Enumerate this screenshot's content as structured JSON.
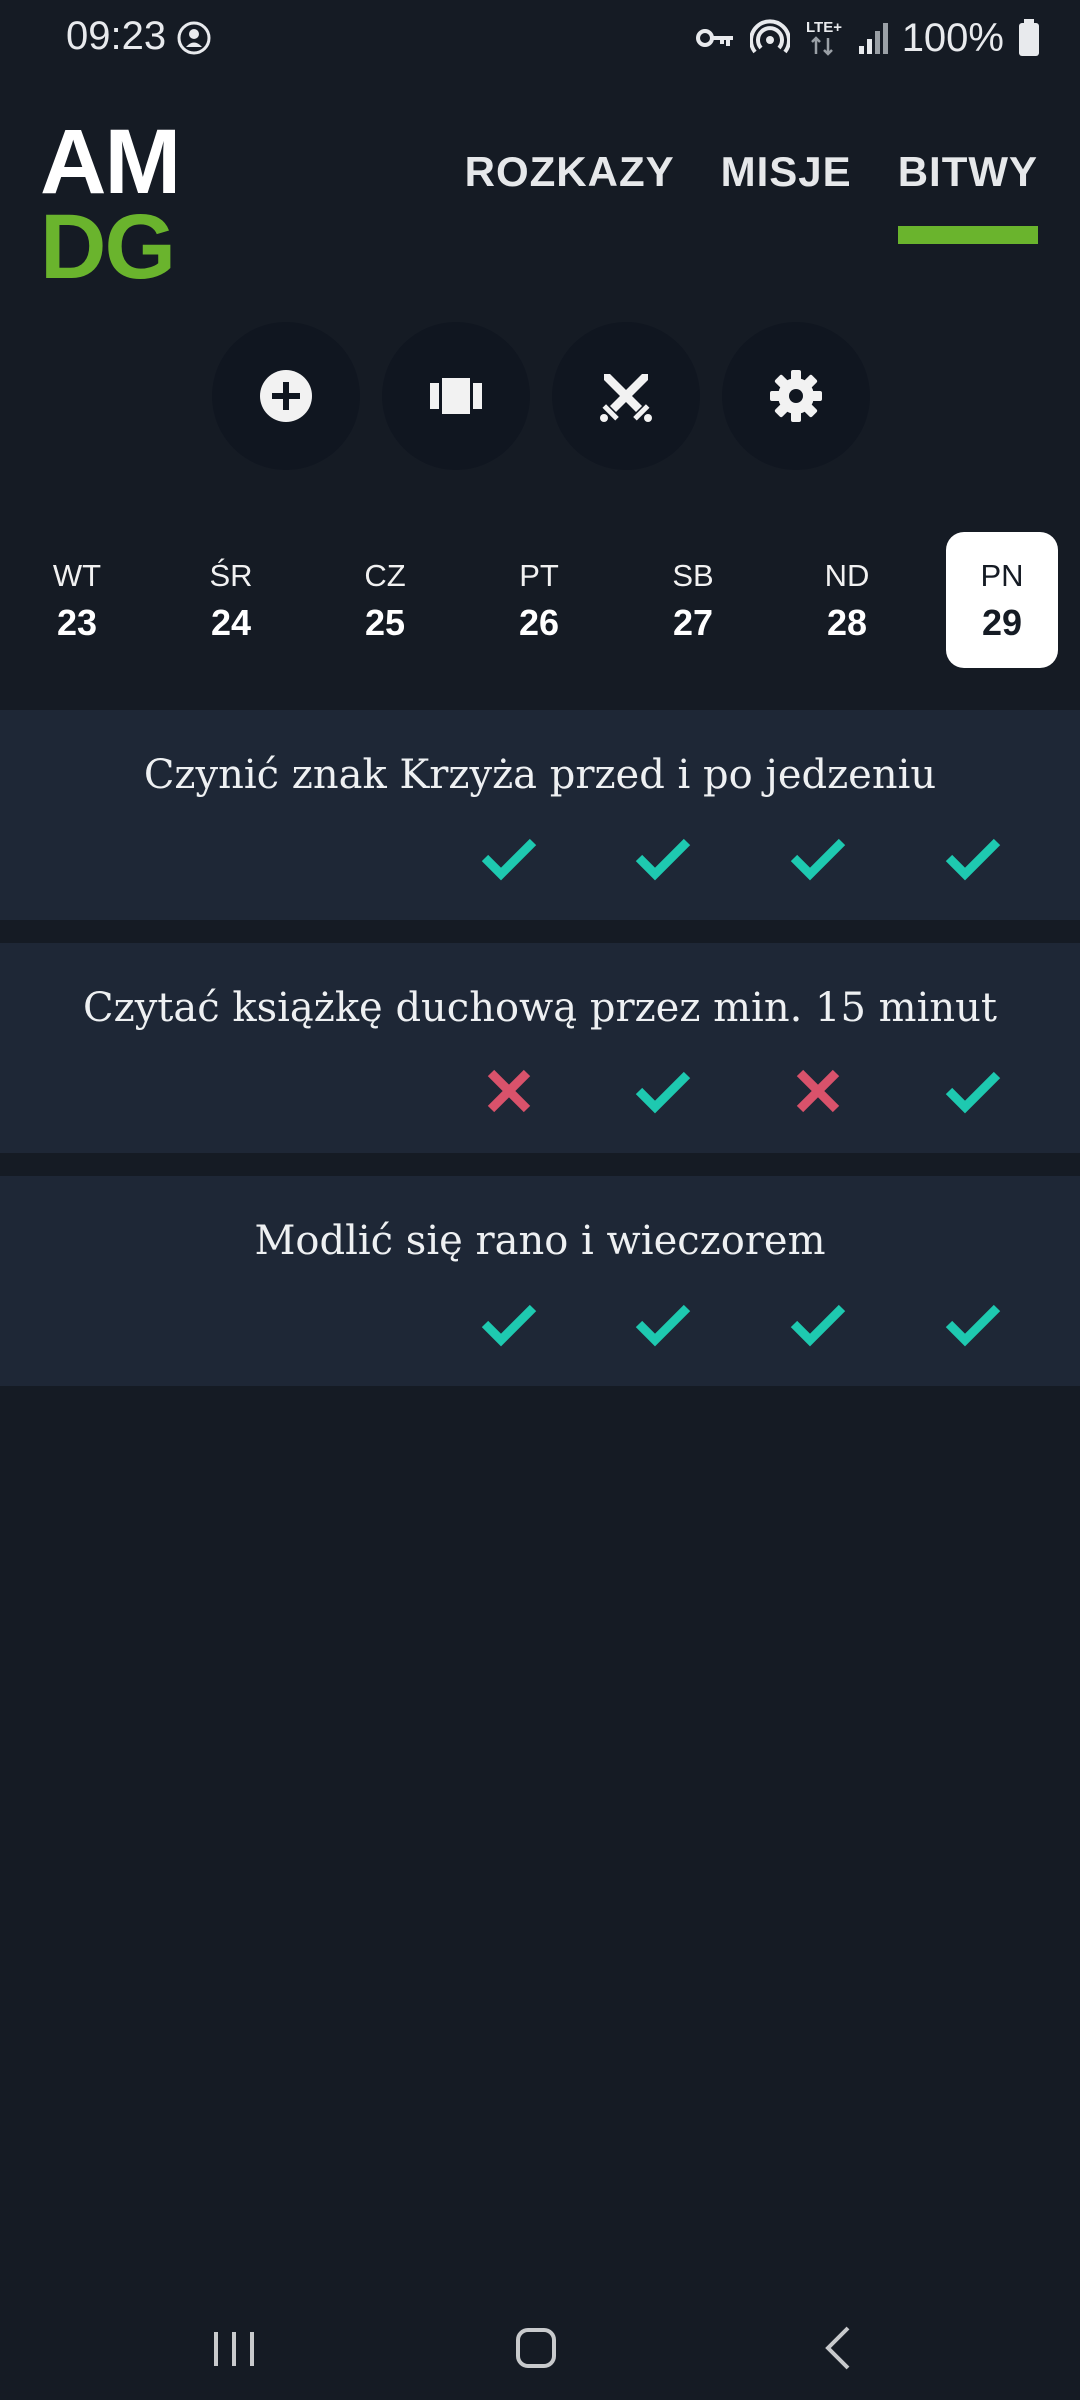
{
  "status_bar": {
    "time": "09:23",
    "battery": "100%",
    "network": "LTE+",
    "icons": [
      "notification-icon",
      "vpn-key-icon",
      "hotspot-icon",
      "lte-icon",
      "signal-icon",
      "battery-icon"
    ]
  },
  "header": {
    "logo_line1": "AM",
    "logo_line2": "DG",
    "tabs": [
      {
        "label": "ROZKAZY",
        "active": false
      },
      {
        "label": "MISJE",
        "active": false
      },
      {
        "label": "BITWY",
        "active": true
      }
    ]
  },
  "actions": [
    {
      "icon": "add-circle-icon"
    },
    {
      "icon": "carousel-icon"
    },
    {
      "icon": "crossed-swords-icon"
    },
    {
      "icon": "settings-gear-icon"
    }
  ],
  "days": [
    {
      "name": "WT",
      "date": "23",
      "selected": false
    },
    {
      "name": "ŚR",
      "date": "24",
      "selected": false
    },
    {
      "name": "CZ",
      "date": "25",
      "selected": false
    },
    {
      "name": "PT",
      "date": "26",
      "selected": false
    },
    {
      "name": "SB",
      "date": "27",
      "selected": false
    },
    {
      "name": "ND",
      "date": "28",
      "selected": false
    },
    {
      "name": "PN",
      "date": "29",
      "selected": true
    }
  ],
  "habits": [
    {
      "title": "Czynić znak Krzyża przed i po jedzeniu",
      "marks": [
        "check",
        "check",
        "check",
        "check"
      ]
    },
    {
      "title": "Czytać książkę duchową przez min. 15 minut",
      "marks": [
        "cross",
        "check",
        "cross",
        "check"
      ]
    },
    {
      "title": "Modlić się rano i wieczorem",
      "marks": [
        "check",
        "check",
        "check",
        "check"
      ]
    }
  ],
  "colors": {
    "background": "#151b24",
    "card": "#1e2736",
    "accent_green": "#6ab42d",
    "check": "#1ec9b0",
    "cross": "#d9526b"
  },
  "navbar": {
    "icons": [
      "recent-apps-icon",
      "home-icon",
      "back-icon"
    ]
  }
}
